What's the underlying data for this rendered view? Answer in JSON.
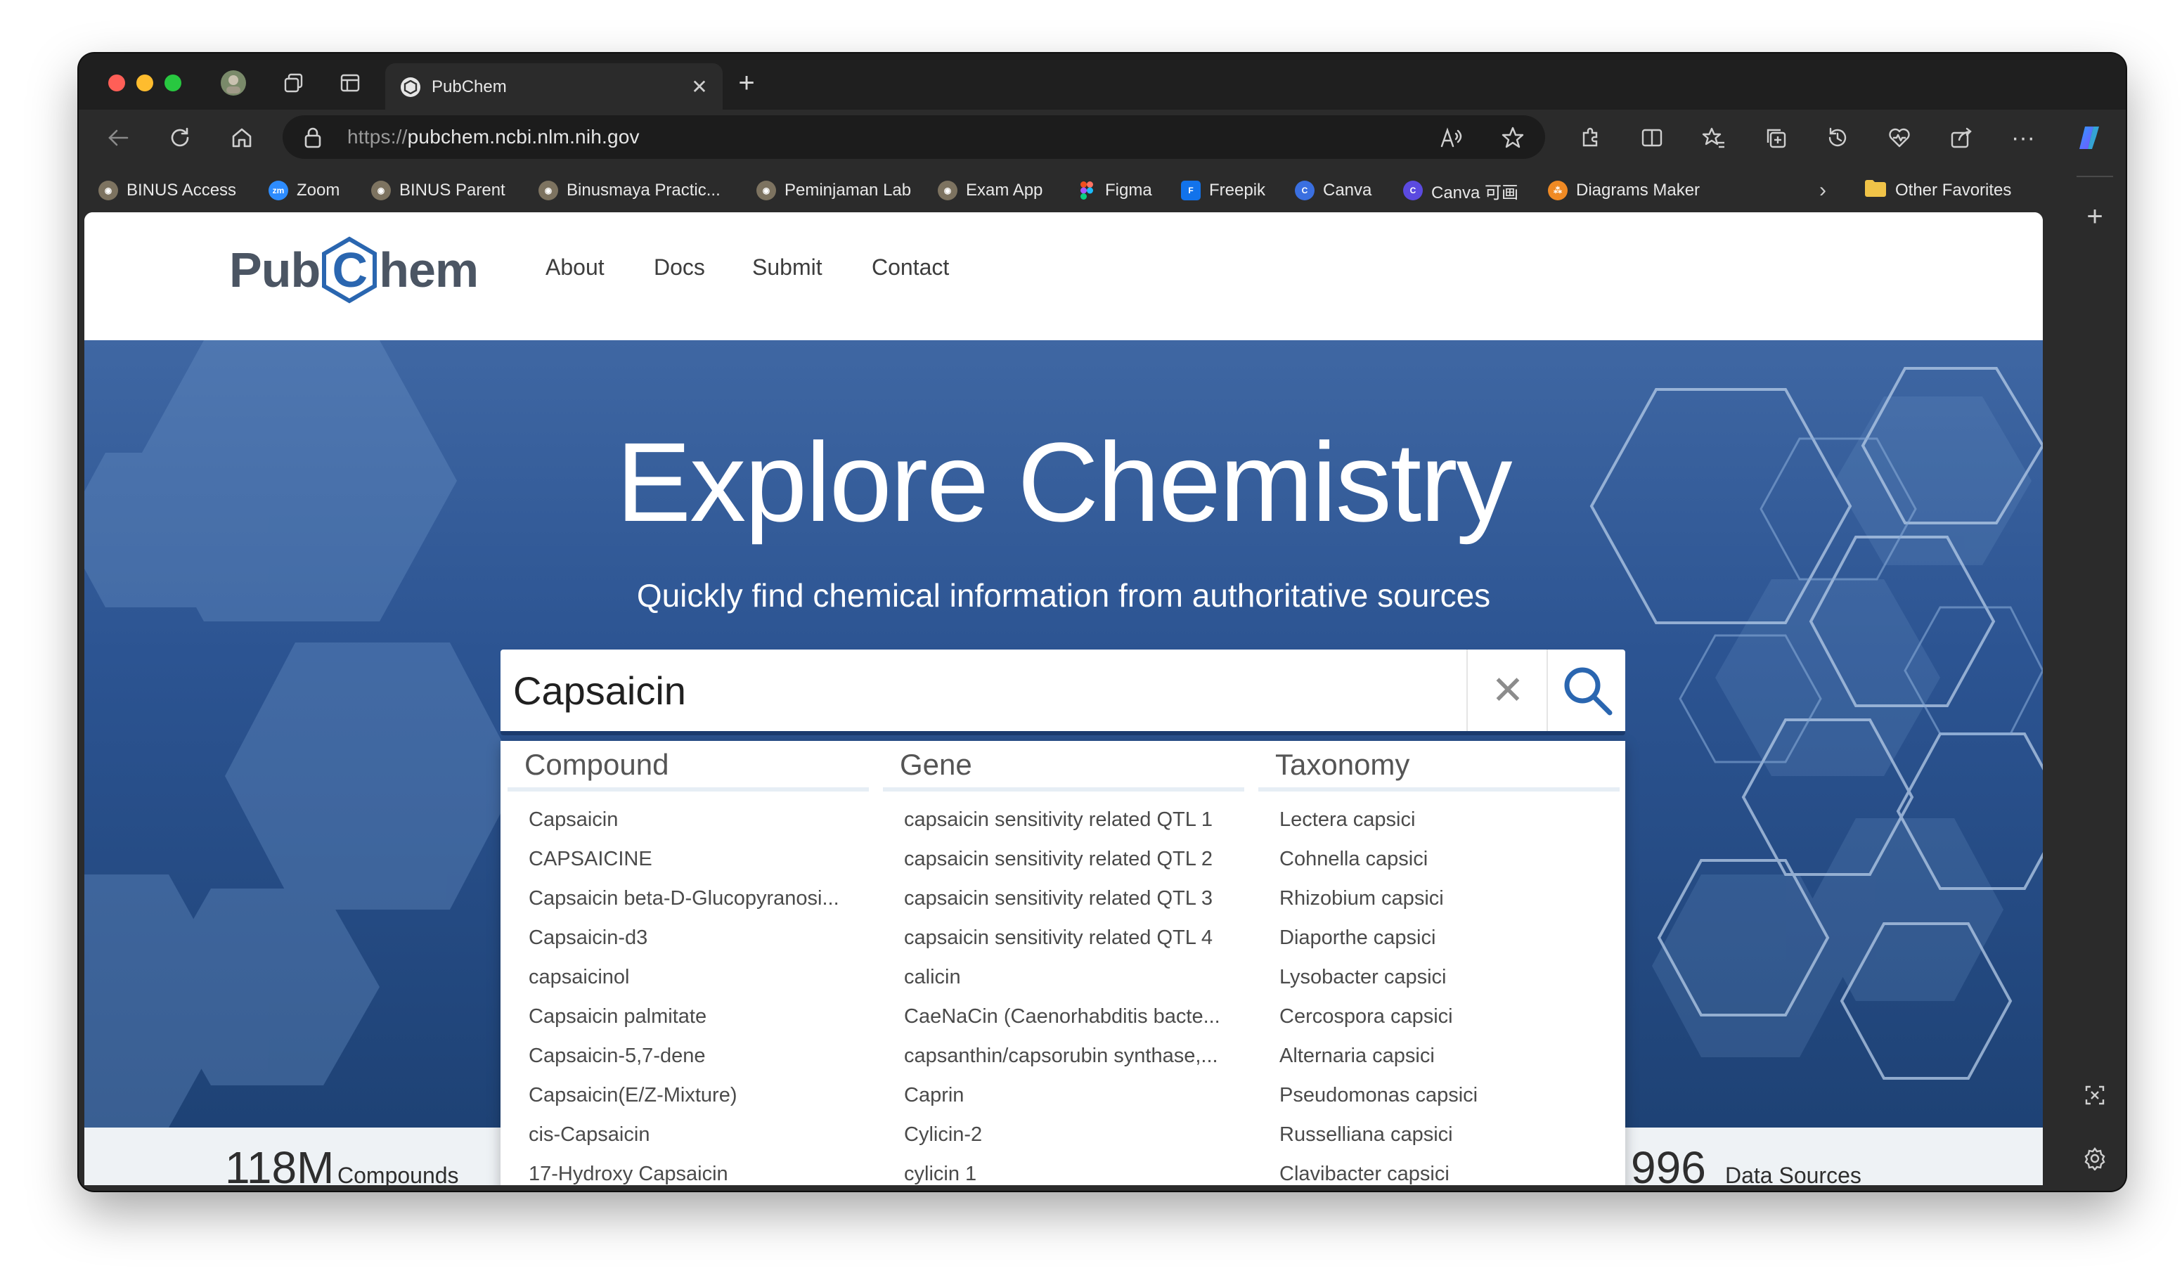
{
  "browser": {
    "tab_title": "PubChem",
    "url_protocol": "https://",
    "url_host": "pubchem.ncbi.nlm.nih.gov",
    "favorites": [
      {
        "label": "BINUS Access",
        "icon": "binus-icon"
      },
      {
        "label": "Zoom",
        "icon": "zoom-icon"
      },
      {
        "label": "BINUS Parent",
        "icon": "binus-icon"
      },
      {
        "label": "Binusmaya Practic...",
        "icon": "binus-icon"
      },
      {
        "label": "Peminjaman Lab",
        "icon": "binus-icon"
      },
      {
        "label": "Exam App",
        "icon": "binus-icon"
      },
      {
        "label": "Figma",
        "icon": "figma-icon"
      },
      {
        "label": "Freepik",
        "icon": "freepik-icon"
      },
      {
        "label": "Canva",
        "icon": "canva-icon"
      },
      {
        "label": "Canva 可画",
        "icon": "canva-icon"
      },
      {
        "label": "Diagrams Maker",
        "icon": "diagrams-icon"
      }
    ],
    "other_favorites": "Other Favorites"
  },
  "site": {
    "logo_left": "Pub",
    "logo_mid": "C",
    "logo_right": "hem",
    "nav": [
      "About",
      "Docs",
      "Submit",
      "Contact"
    ]
  },
  "hero": {
    "title": "Explore Chemistry",
    "subtitle": "Quickly find chemical information from authoritative sources"
  },
  "search": {
    "value": "Capsaicin"
  },
  "suggestions": {
    "compound": {
      "header": "Compound",
      "items": [
        "Capsaicin",
        "CAPSAICINE",
        "Capsaicin beta-D-Glucopyranosi...",
        "Capsaicin-d3",
        "capsaicinol",
        "Capsaicin palmitate",
        "Capsaicin-5,7-dene",
        "Capsaicin(E/Z-Mixture)",
        "cis-Capsaicin",
        "17-Hydroxy Capsaicin"
      ]
    },
    "gene": {
      "header": "Gene",
      "items": [
        "capsaicin sensitivity related QTL 1",
        "capsaicin sensitivity related QTL 2",
        "capsaicin sensitivity related QTL 3",
        "capsaicin sensitivity related QTL 4",
        "calicin",
        "CaeNaCin (Caenorhabditis bacte...",
        "capsanthin/capsorubin synthase,...",
        "Caprin",
        "Cylicin-2",
        "cylicin 1"
      ]
    },
    "taxonomy": {
      "header": "Taxonomy",
      "items": [
        "Lectera capsici",
        "Cohnella capsici",
        "Rhizobium capsici",
        "Diaporthe capsici",
        "Lysobacter capsici",
        "Cercospora capsici",
        "Alternaria capsici",
        "Pseudomonas capsici",
        "Russelliana capsici",
        "Clavibacter capsici"
      ]
    }
  },
  "stats": {
    "compounds_num": "118M",
    "compounds_label": "Compounds",
    "sources_num": "996",
    "sources_label": "Data Sources"
  },
  "colors": {
    "hero_top": "#3f67a3",
    "hero_bottom": "#1e4275",
    "logo_blue": "#2a66b0"
  }
}
